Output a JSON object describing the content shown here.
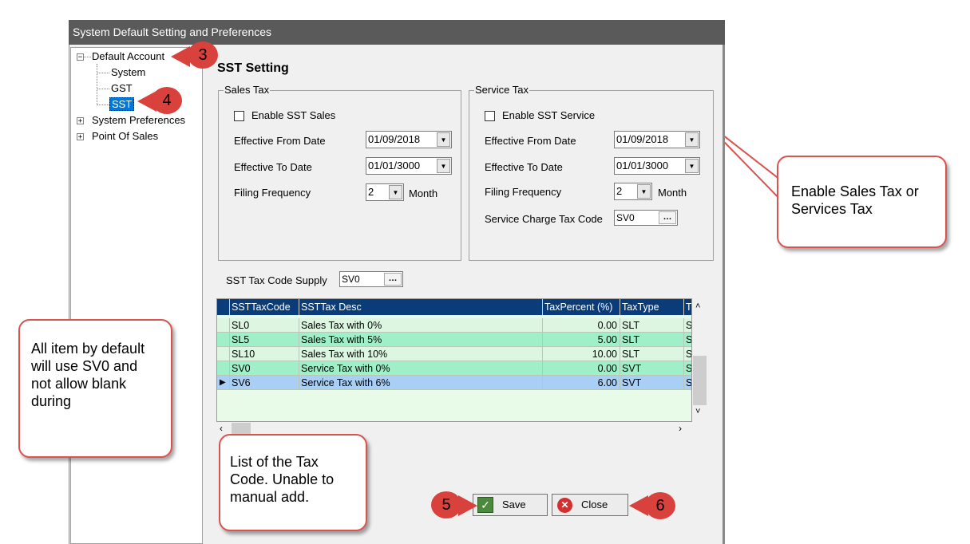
{
  "window": {
    "title": "System Default Setting and Preferences"
  },
  "tree": {
    "root": "Default Account",
    "children": [
      "System",
      "GST",
      "SST"
    ],
    "selected": "SST",
    "siblings": [
      "System Preferences",
      "Point Of Sales"
    ]
  },
  "section_title": "SST Setting",
  "sales_tax": {
    "group_title": "Sales Tax",
    "enable_label": "Enable SST Sales",
    "from_label": "Effective From Date",
    "from_value": "01/09/2018",
    "to_label": "Effective To Date",
    "to_value": "01/01/3000",
    "freq_label": "Filing Frequency",
    "freq_value": "2",
    "freq_unit": "Month"
  },
  "service_tax": {
    "group_title": "Service Tax",
    "enable_label": "Enable SST Service",
    "from_label": "Effective From Date",
    "from_value": "01/09/2018",
    "to_label": "Effective To Date",
    "to_value": "01/01/3000",
    "freq_label": "Filing Frequency",
    "freq_value": "2",
    "freq_unit": "Month",
    "charge_label": "Service Charge Tax Code",
    "charge_value": "SV0"
  },
  "supply": {
    "label": "SST Tax Code Supply",
    "value": "SV0"
  },
  "grid": {
    "headers": [
      "SSTTaxCode",
      "SSTTax Desc",
      "TaxPercent (%)",
      "TaxType",
      "T"
    ],
    "rows": [
      [
        "SL0",
        "Sales Tax with 0%",
        "0.00",
        "SLT",
        "S"
      ],
      [
        "SL5",
        "Sales Tax with 5%",
        "5.00",
        "SLT",
        "S"
      ],
      [
        "SL10",
        "Sales Tax with 10%",
        "10.00",
        "SLT",
        "S"
      ],
      [
        "SV0",
        "Service Tax with 0%",
        "0.00",
        "SVT",
        "S"
      ],
      [
        "SV6",
        "Service Tax with 6%",
        "6.00",
        "SVT",
        "S"
      ]
    ]
  },
  "buttons": {
    "save": "Save",
    "close": "Close"
  },
  "annotations": {
    "callout_enable": "Enable Sales Tax or Services Tax",
    "callout_default": "All item by default will use SV0 and not allow blank during",
    "callout_list": "List of the Tax Code. Unable to manual add.",
    "badge_3": "3",
    "badge_4": "4",
    "badge_5": "5",
    "badge_6": "6"
  },
  "colors": {
    "header_bg": "#0b3c7a",
    "row_light": "#dcf6e1",
    "row_green": "#9ff0c8",
    "row_selected": "#a9cff5",
    "callout_border": "#d9534f",
    "badge": "#d9413c"
  }
}
